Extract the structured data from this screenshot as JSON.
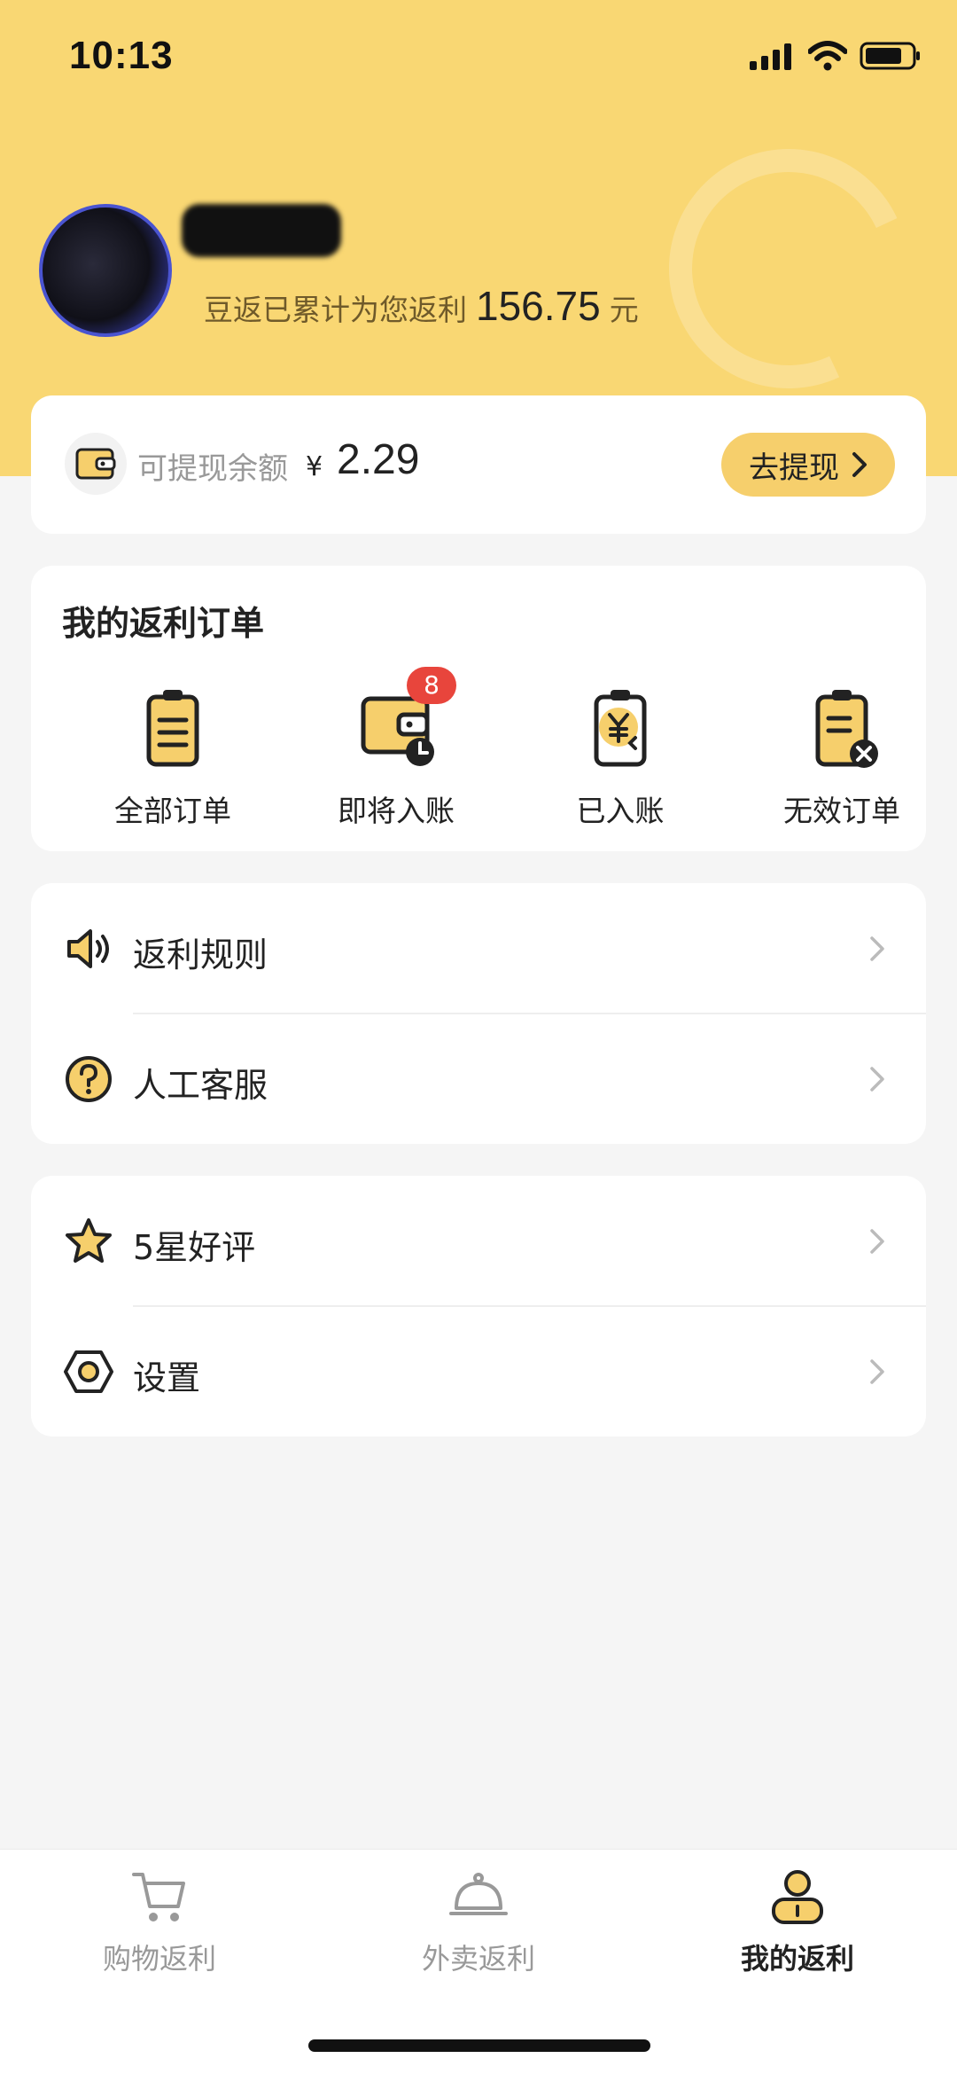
{
  "status_bar": {
    "time": "10:13"
  },
  "profile": {
    "username": "",
    "rebate_prefix": "豆返已累计为您返利",
    "rebate_amount": "156.75",
    "rebate_unit": "元"
  },
  "balance": {
    "label": "可提现余额",
    "currency": "¥",
    "value": "2.29",
    "withdraw_label": "去提现"
  },
  "orders": {
    "title": "我的返利订单",
    "items": [
      {
        "label": "全部订单",
        "icon": "clipboard-list-icon"
      },
      {
        "label": "即将入账",
        "icon": "wallet-clock-icon",
        "badge": "8"
      },
      {
        "label": "已入账",
        "icon": "clipboard-yen-icon"
      },
      {
        "label": "无效订单",
        "icon": "clipboard-x-icon"
      }
    ]
  },
  "menu_group1": [
    {
      "label": "返利规则",
      "icon": "speaker-icon"
    },
    {
      "label": "人工客服",
      "icon": "help-circle-icon"
    }
  ],
  "menu_group2": [
    {
      "label": "5星好评",
      "icon": "star-icon"
    },
    {
      "label": "设置",
      "icon": "settings-hexagon-icon"
    }
  ],
  "tabbar": [
    {
      "label": "购物返利",
      "icon": "cart-icon",
      "active": false
    },
    {
      "label": "外卖返利",
      "icon": "food-cloche-icon",
      "active": false
    },
    {
      "label": "我的返利",
      "icon": "user-icon",
      "active": true
    }
  ],
  "colors": {
    "accent": "#f9d773",
    "button": "#f6cf6c",
    "badge": "#e8453c"
  }
}
